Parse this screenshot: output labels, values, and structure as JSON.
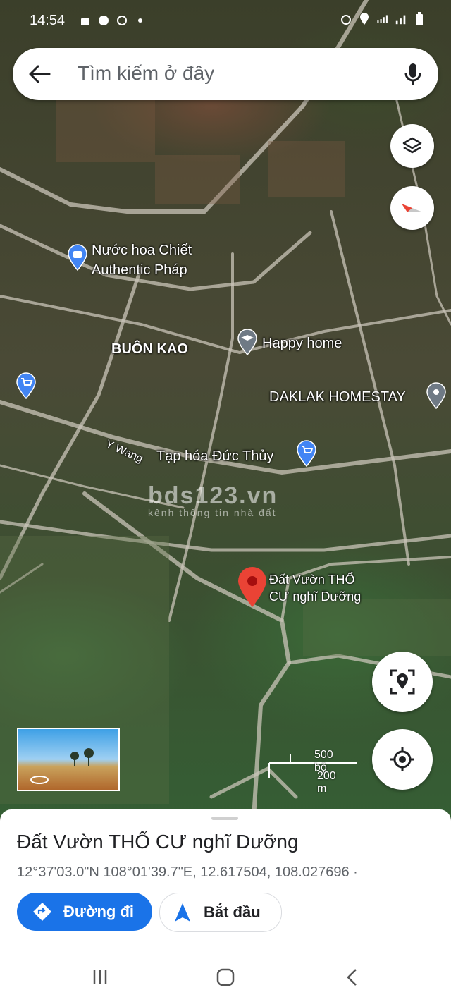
{
  "status_bar": {
    "time": "14:54"
  },
  "search": {
    "placeholder": "Tìm kiếm ở đây"
  },
  "map": {
    "labels": [
      {
        "text": "Nước hoa Chiết",
        "kind": "poi-shop"
      },
      {
        "text": "Authentic Pháp",
        "kind": "poi-shop"
      },
      {
        "text": "BUÔN KAO",
        "kind": "area"
      },
      {
        "text": "Happy home",
        "kind": "poi-school"
      },
      {
        "text": "DAKLAK HOMESTAY",
        "kind": "poi-place"
      },
      {
        "text": "Y Wang",
        "kind": "street"
      },
      {
        "text": "Tạp hóa Đức Thủy",
        "kind": "poi-shop"
      },
      {
        "text": "Đất Vườn THỔ",
        "kind": "pin"
      },
      {
        "text": "CƯ nghĩ Dưỡng",
        "kind": "pin"
      }
    ],
    "watermark": {
      "title": "bds123.vn",
      "subtitle": "kênh thông tin nhà đất"
    },
    "scale": {
      "imperial": "500 bộ",
      "metric": "200 m"
    }
  },
  "place": {
    "title": "Đất Vườn THỔ CƯ nghĩ Dưỡng",
    "coords": "12°37'03.0\"N 108°01'39.7\"E, 12.617504, 108.027696 ·"
  },
  "actions": {
    "directions": "Đường đi",
    "start": "Bắt đầu"
  },
  "colors": {
    "accent": "#1a73e8",
    "pin": "#ea4335",
    "poi_blue": "#4285f4",
    "poi_gray": "#6f7a85"
  }
}
